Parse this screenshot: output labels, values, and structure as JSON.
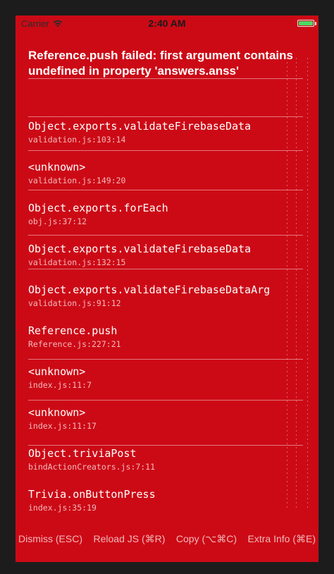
{
  "status_bar": {
    "carrier": "Carrier",
    "time": "2:40 AM",
    "battery_color": "#4cd964"
  },
  "error": {
    "title": "Reference.push failed: first argument contains undefined in property 'answers.anss'"
  },
  "stack_frames": [
    {
      "method": "Object.exports.validateFirebaseData",
      "location": "validation.js:103:14"
    },
    {
      "method": "<unknown>",
      "location": "validation.js:149:20"
    },
    {
      "method": "Object.exports.forEach",
      "location": "obj.js:37:12"
    },
    {
      "method": "Object.exports.validateFirebaseData",
      "location": "validation.js:132:15"
    },
    {
      "method": "Object.exports.validateFirebaseDataArg",
      "location": "validation.js:91:12"
    },
    {
      "method": "Reference.push",
      "location": "Reference.js:227:21"
    },
    {
      "method": "<unknown>",
      "location": "index.js:11:7"
    },
    {
      "method": "<unknown>",
      "location": "index.js:11:17"
    },
    {
      "method": "Object.triviaPost",
      "location": "bindActionCreators.js:7:11"
    },
    {
      "method": "Trivia.onButtonPress",
      "location": "index.js:35:19"
    }
  ],
  "actions": {
    "dismiss": "Dismiss (ESC)",
    "reload": "Reload JS (⌘R)",
    "copy": "Copy (⌥⌘C)",
    "extra_info": "Extra Info (⌘E)"
  },
  "colors": {
    "background": "#cc0a16",
    "text": "#ffffff",
    "secondary_text": "#f2b8bb"
  },
  "icons": {
    "wifi": "wifi-icon",
    "battery": "battery-icon"
  }
}
